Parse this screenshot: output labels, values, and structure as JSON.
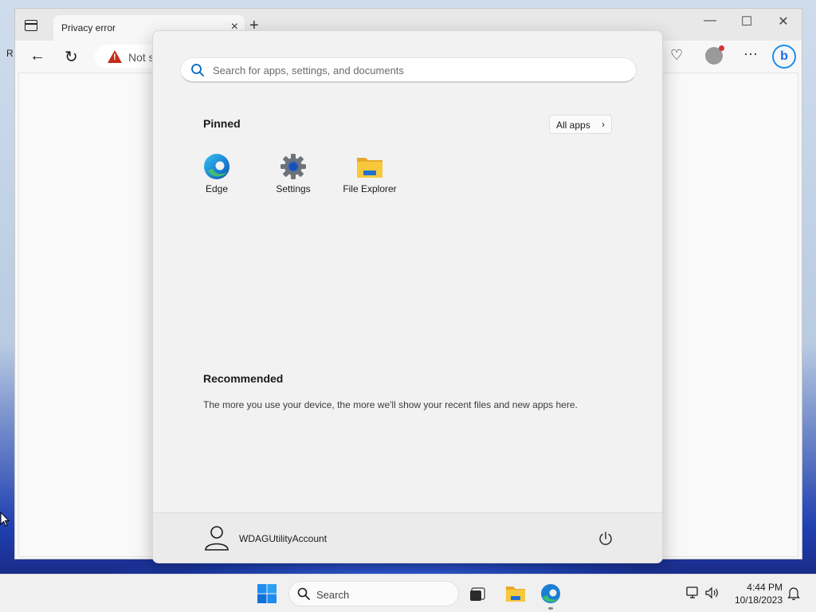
{
  "browser": {
    "tab_title": "Privacy error",
    "tab_close": "×",
    "new_tab": "+",
    "address_text": "Not s",
    "desktop_letter": "R"
  },
  "start_menu": {
    "search_placeholder": "Search for apps, settings, and documents",
    "pinned_title": "Pinned",
    "all_apps_label": "All apps",
    "all_apps_chevron": "›",
    "pinned_apps": [
      {
        "label": "Edge",
        "icon": "edge-icon"
      },
      {
        "label": "Settings",
        "icon": "settings-icon"
      },
      {
        "label": "File Explorer",
        "icon": "file-explorer-icon"
      }
    ],
    "recommended_title": "Recommended",
    "recommended_text": "The more you use your device, the more we'll show your recent files and new apps here.",
    "user_name": "WDAGUtilityAccount"
  },
  "taskbar": {
    "search_label": "Search",
    "time": "4:44 PM",
    "date": "10/18/2023"
  },
  "colors": {
    "accent": "#0067c0",
    "warning": "#c42b1c",
    "folder": "#f8c83c"
  }
}
